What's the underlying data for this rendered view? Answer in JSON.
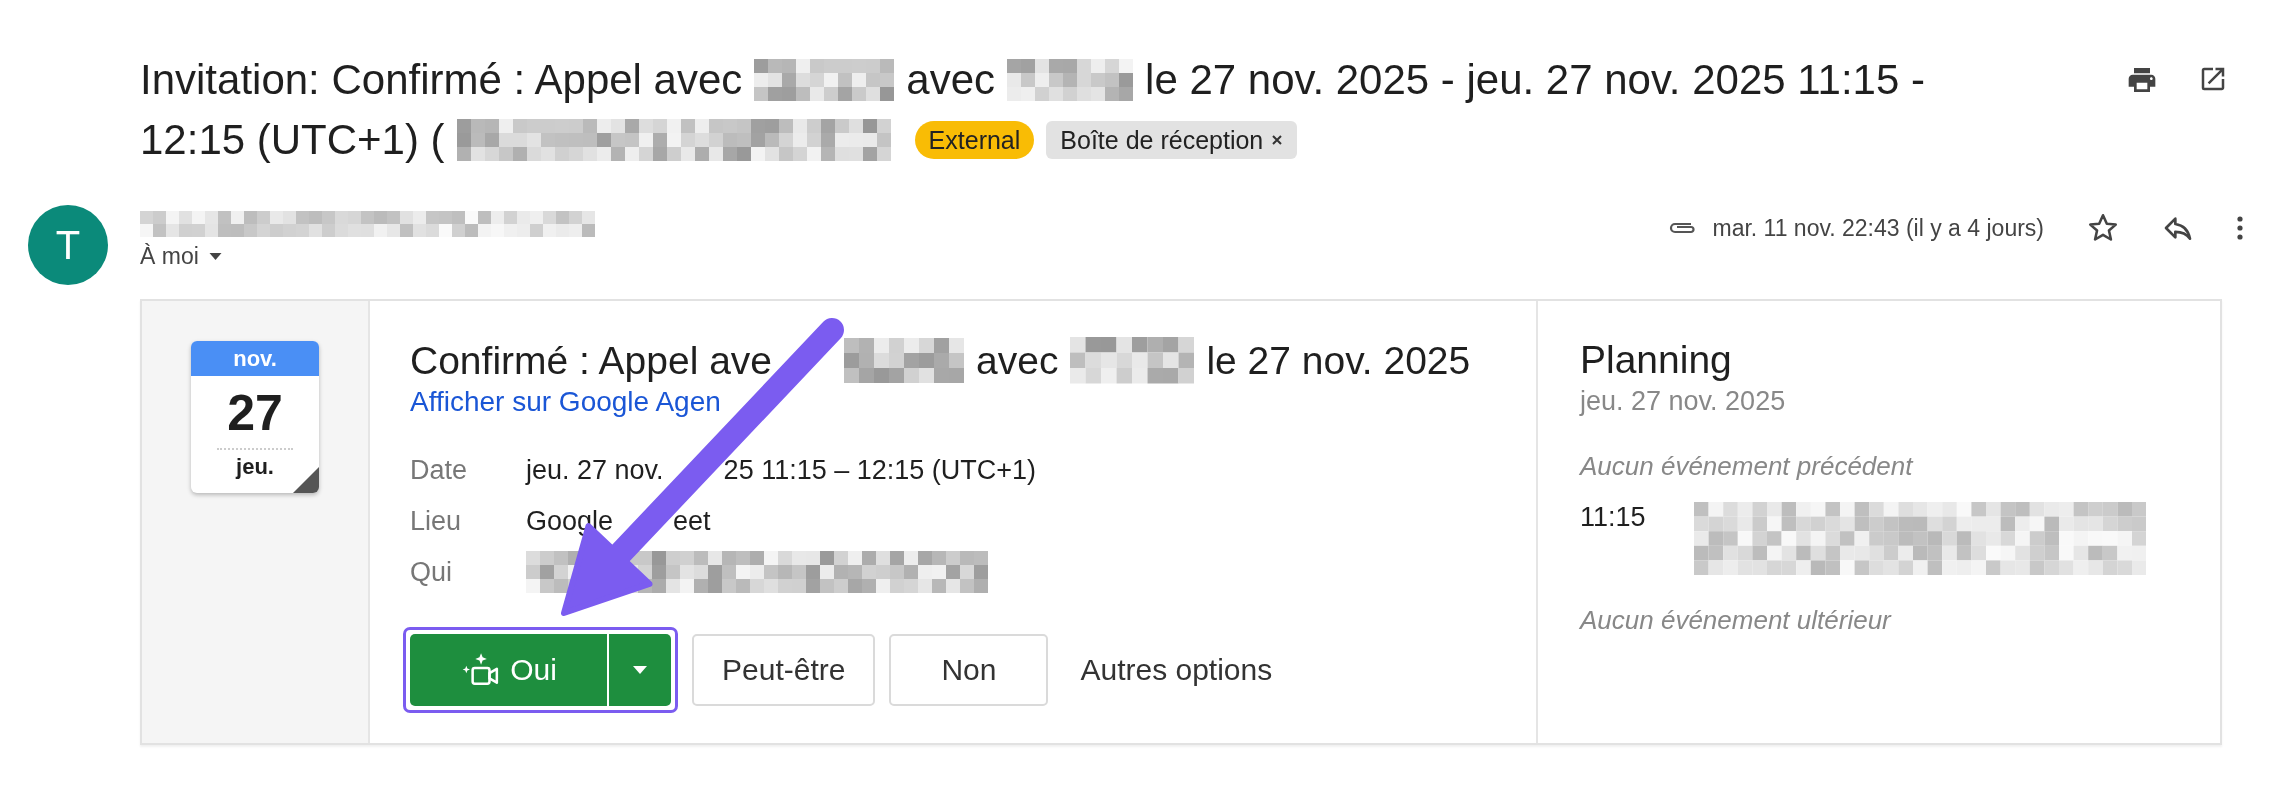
{
  "subject": {
    "lines": [
      [
        {
          "kind": "text",
          "text": "Invitation: Confirmé : Appel avec"
        },
        {
          "kind": "redacted"
        },
        {
          "kind": "text",
          "text": "avec"
        },
        {
          "kind": "redacted"
        },
        {
          "kind": "text",
          "text": "le 27 nov. 2025 - jeu. 27 nov. 2025 11:15 -"
        }
      ],
      [
        {
          "kind": "text",
          "text": "12:15 (UTC+1) ("
        },
        {
          "kind": "redacted"
        }
      ]
    ],
    "labels": [
      {
        "kind": "external",
        "text": "External"
      },
      {
        "kind": "folder",
        "text": "Boîte de réception"
      }
    ]
  },
  "message": {
    "avatar": "T",
    "recipient": "À moi",
    "date": "mar. 11 nov. 22:43 (il y a 4 jours)"
  },
  "event": {
    "calendar": {
      "month": "nov.",
      "day": "27",
      "weekday": "jeu."
    },
    "title_segments": [
      {
        "kind": "text",
        "text": "Confirmé : Appel ave"
      },
      {
        "kind": "gap"
      },
      {
        "kind": "redacted"
      },
      {
        "kind": "text",
        "text": "avec"
      },
      {
        "kind": "redacted"
      },
      {
        "kind": "text",
        "text": "le 27 nov. 2025"
      }
    ],
    "link": "Afficher sur Google Agen",
    "details": [
      {
        "label": "Date",
        "segments": [
          {
            "kind": "text",
            "text": "jeu. 27 nov."
          },
          {
            "kind": "gap"
          },
          {
            "kind": "text",
            "text": "25 11:15 – 12:15 (UTC+1)"
          }
        ]
      },
      {
        "label": "Lieu",
        "segments": [
          {
            "kind": "text",
            "text": "Google"
          },
          {
            "kind": "gap"
          },
          {
            "kind": "text",
            "text": "eet"
          }
        ]
      },
      {
        "label": "Qui",
        "segments": [
          {
            "kind": "redacted"
          }
        ]
      }
    ],
    "rsvp": {
      "focused": true,
      "buttons": [
        {
          "kind": "primary",
          "label": "Oui"
        },
        {
          "kind": "outline",
          "label": "Peut-être"
        },
        {
          "kind": "outline",
          "label": "Non"
        },
        {
          "kind": "plain",
          "label": "Autres options"
        }
      ]
    }
  },
  "planning": {
    "title": "Planning",
    "date": "jeu. 27 nov. 2025",
    "before": "Aucun événement précédent",
    "events": [
      {
        "time": "11:15"
      }
    ],
    "after": "Aucun événement ultérieur"
  }
}
